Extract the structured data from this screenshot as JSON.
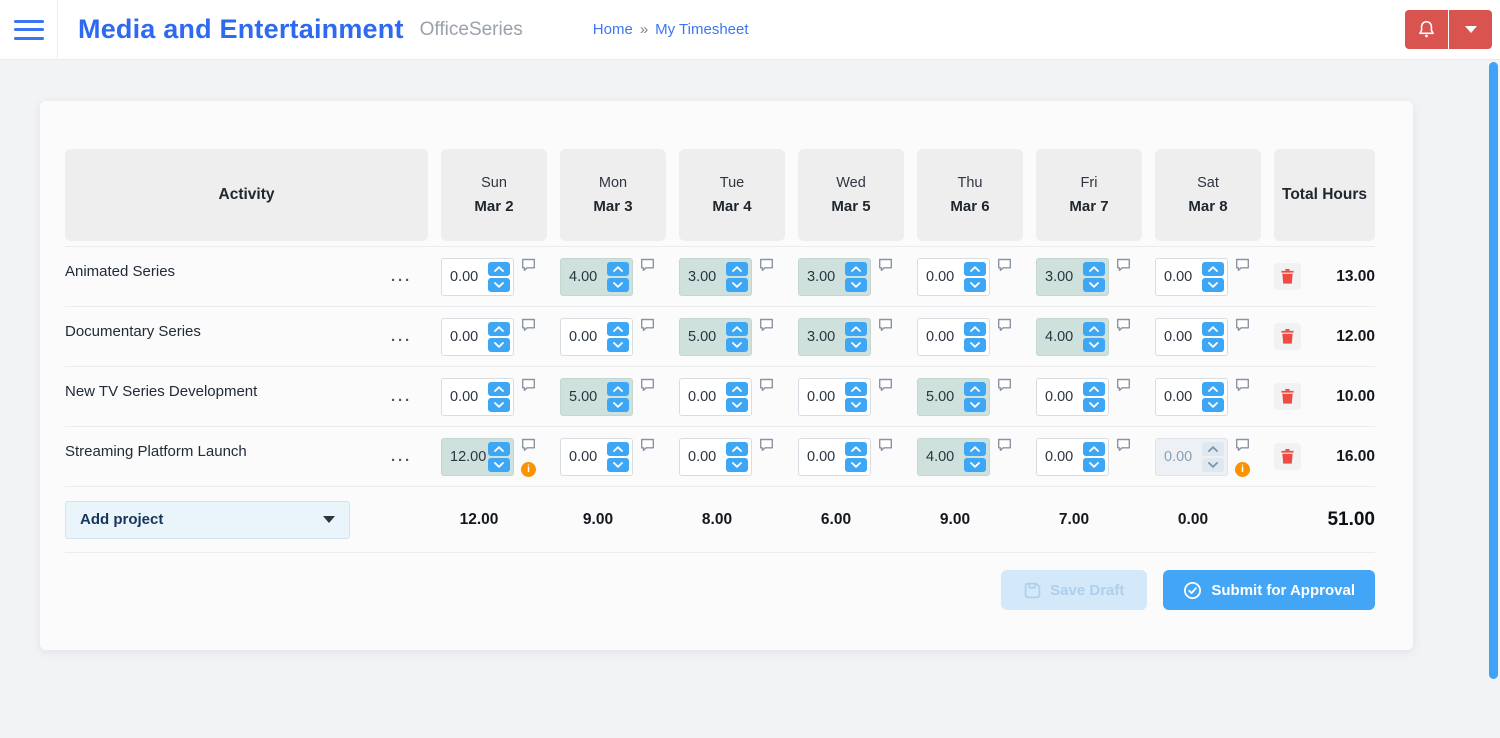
{
  "header": {
    "title": "Media and Entertainment",
    "brand": "OfficeSeries",
    "breadcrumb": {
      "home": "Home",
      "separator": "»",
      "current": "My Timesheet"
    }
  },
  "table": {
    "activity_header": "Activity",
    "total_header": "Total Hours",
    "row_menu_glyph": "···",
    "info_glyph": "i",
    "days": [
      {
        "day": "Sun",
        "date": "Mar 2"
      },
      {
        "day": "Mon",
        "date": "Mar 3"
      },
      {
        "day": "Tue",
        "date": "Mar 4"
      },
      {
        "day": "Wed",
        "date": "Mar 5"
      },
      {
        "day": "Thu",
        "date": "Mar 6"
      },
      {
        "day": "Fri",
        "date": "Mar 7"
      },
      {
        "day": "Sat",
        "date": "Mar 8"
      }
    ],
    "rows": [
      {
        "name": "Animated Series",
        "values": [
          "0.00",
          "4.00",
          "3.00",
          "3.00",
          "0.00",
          "3.00",
          "0.00"
        ],
        "total": "13.00",
        "info_cells": [],
        "disabled_cells": []
      },
      {
        "name": "Documentary Series",
        "values": [
          "0.00",
          "0.00",
          "5.00",
          "3.00",
          "0.00",
          "4.00",
          "0.00"
        ],
        "total": "12.00",
        "info_cells": [],
        "disabled_cells": []
      },
      {
        "name": "New TV Series Development",
        "values": [
          "0.00",
          "5.00",
          "0.00",
          "0.00",
          "5.00",
          "0.00",
          "0.00"
        ],
        "total": "10.00",
        "info_cells": [],
        "disabled_cells": []
      },
      {
        "name": "Streaming Platform Launch",
        "values": [
          "12.00",
          "0.00",
          "0.00",
          "0.00",
          "4.00",
          "0.00",
          "0.00"
        ],
        "total": "16.00",
        "info_cells": [
          0,
          6
        ],
        "disabled_cells": [
          6
        ]
      }
    ],
    "footer": {
      "add_project": "Add project",
      "day_totals": [
        "12.00",
        "9.00",
        "8.00",
        "6.00",
        "9.00",
        "7.00",
        "0.00"
      ],
      "grand_total": "51.00"
    }
  },
  "actions": {
    "save_draft": "Save Draft",
    "submit": "Submit for Approval"
  },
  "colors": {
    "title_blue": "#2e6af0",
    "link_blue": "#3c78f1",
    "spinner_blue": "#3da7f5",
    "submit_blue": "#42a5f5",
    "header_red": "#d9534f",
    "trash_red": "#ee4b43",
    "filled_cell_green": "#cfe1dc",
    "info_orange": "#fb9200",
    "scrollbar_blue": "#3ea2f7"
  }
}
